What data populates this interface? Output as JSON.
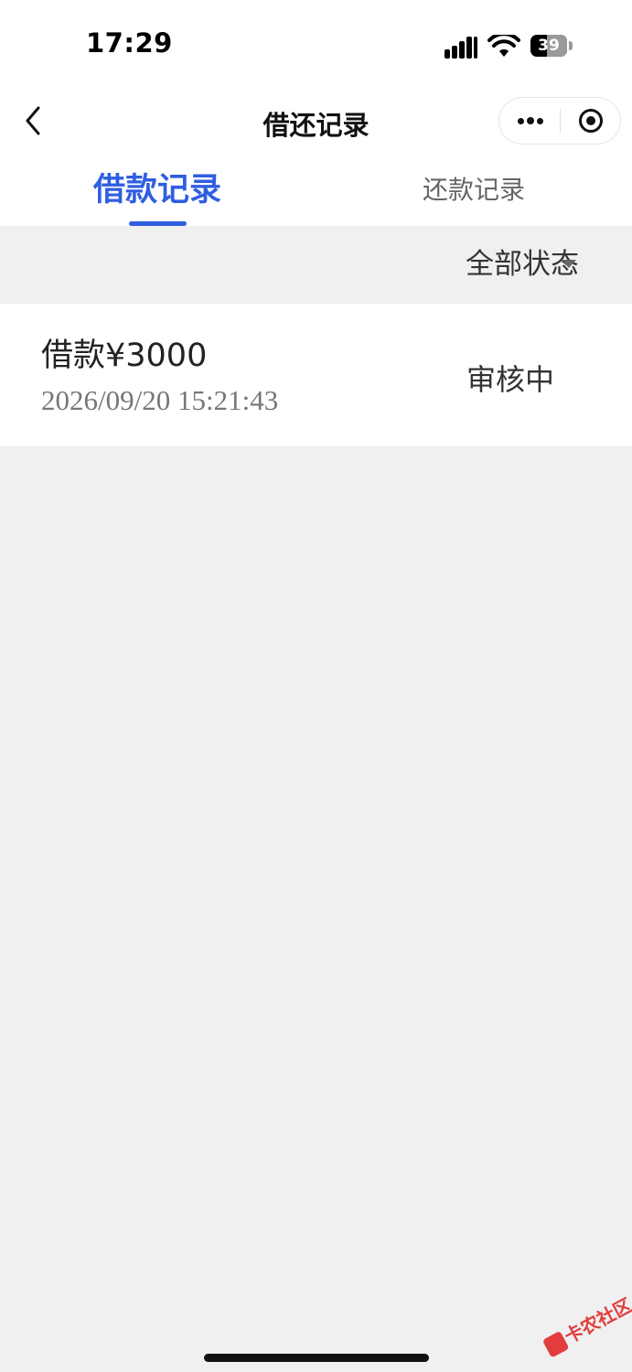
{
  "status_bar": {
    "time": "17:29",
    "battery": "39",
    "icons": [
      "signal-icon",
      "wifi-icon",
      "battery-icon"
    ]
  },
  "nav": {
    "title": "借还记录",
    "back_icon": "chevron-left-icon",
    "more_icon": "more-dots-icon",
    "close_icon": "target-circle-icon"
  },
  "tabs": [
    {
      "label": "借款记录",
      "active": true
    },
    {
      "label": "还款记录",
      "active": false
    }
  ],
  "filter": {
    "label": "全部状态",
    "icon": "caret-down-icon"
  },
  "records": [
    {
      "title": "借款¥3000",
      "time": "2026/09/20 15:21:43",
      "status": "审核中"
    }
  ],
  "watermark": {
    "text": "卡农社区"
  },
  "colors": {
    "accent": "#2f5ee0",
    "background": "#f0f0f0",
    "card": "#ffffff",
    "watermark": "#e23d3d"
  }
}
